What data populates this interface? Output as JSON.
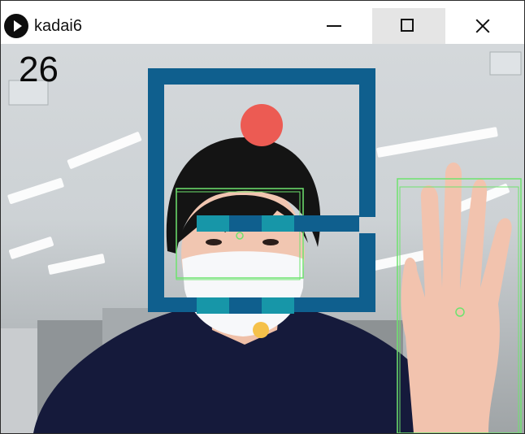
{
  "window": {
    "title": "kadai6",
    "controls": {
      "minimize": "minimize",
      "maximize": "maximize",
      "close": "close"
    }
  },
  "game": {
    "score": "26",
    "colors": {
      "frame": "#0f5f8e",
      "paddle_teal": "#1796a8",
      "paddle_dark": "#0f5f8e",
      "ball_red": "#ec5b53",
      "ball_yellow": "#f5c14a",
      "detection": "#6ee36e",
      "shirt": "#151a3b",
      "skin": "#f1c6b1",
      "mask": "#f7f8fa",
      "hair": "#141414"
    },
    "icons": {
      "app": "play-icon",
      "minimize": "minimize-icon",
      "maximize": "maximize-icon",
      "close": "close-icon"
    }
  }
}
